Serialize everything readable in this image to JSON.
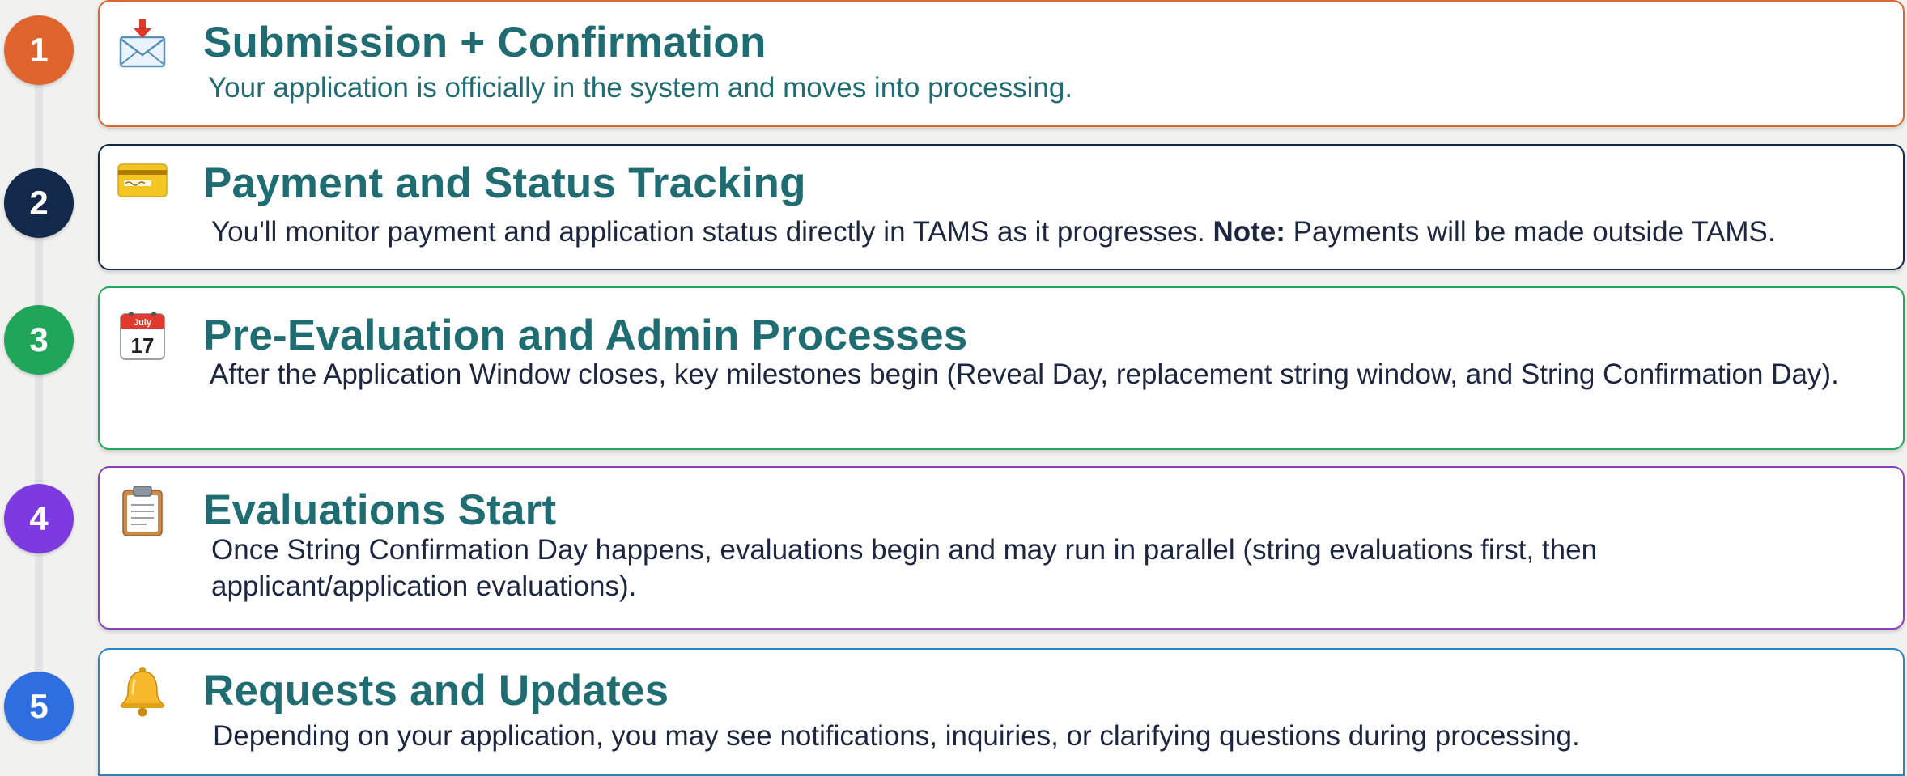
{
  "steps": [
    {
      "number": "1",
      "icon": "envelope-with-arrow-icon",
      "color": "#e0642e",
      "title": "Submission + Confirmation",
      "description": "Your application is officially in the system and moves into processing.",
      "description_color": "#1f6d72"
    },
    {
      "number": "2",
      "icon": "credit-card-icon",
      "color": "#13294b",
      "title": "Payment and Status Tracking",
      "description_before": "You'll monitor payment and application status directly in TAMS as it progresses. ",
      "note_label": "Note:",
      "description_after": " Payments will be made outside TAMS."
    },
    {
      "number": "3",
      "icon": "calendar-icon",
      "color": "#1fa65a",
      "calendar_month": "July",
      "calendar_day": "17",
      "title": "Pre-Evaluation and Admin Processes",
      "description": "After the Application Window closes, key milestones begin (Reveal Day, replacement string window, and String Confirmation Day)."
    },
    {
      "number": "4",
      "icon": "clipboard-icon",
      "color": "#7d3ae0",
      "title": "Evaluations Start",
      "description": "Once String Confirmation Day happens, evaluations begin and may run in parallel (string evaluations first, then applicant/application evaluations)."
    },
    {
      "number": "5",
      "icon": "bell-icon",
      "color": "#2f6ee0",
      "title": "Requests and Updates",
      "description": "Depending on your application, you may see notifications, inquiries, or clarifying questions during processing."
    }
  ],
  "colors": {
    "title": "#1f6d72",
    "body_text": "#1c2640",
    "background": "#f1f1f0",
    "card_border_1": "#e0642e",
    "card_border_2": "#13294b",
    "card_border_3": "#22a85a",
    "card_border_4": "#8a3fbf",
    "card_border_5": "#2e86c1"
  }
}
